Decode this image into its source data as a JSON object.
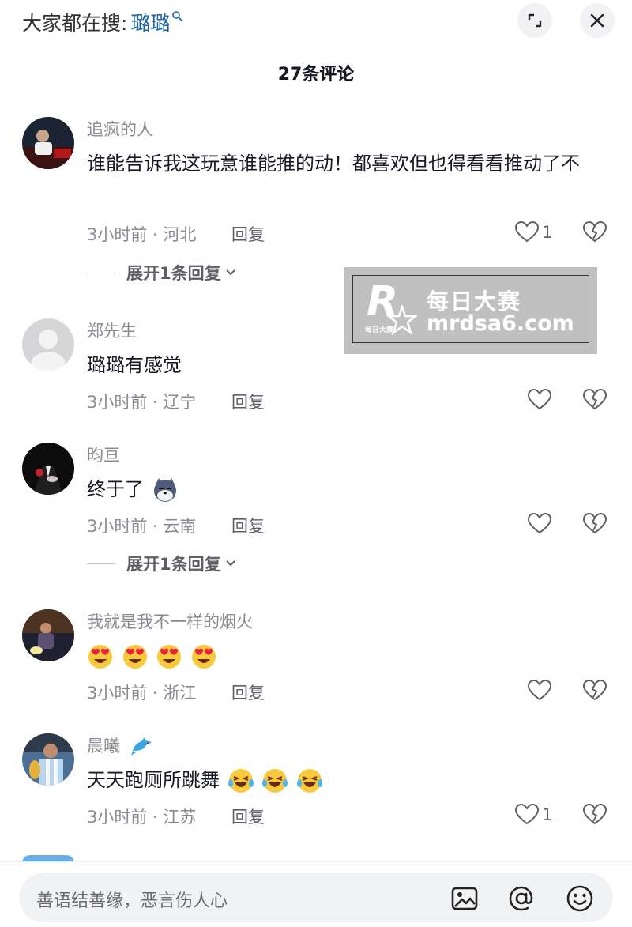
{
  "header": {
    "trending_label": "大家都在搜:",
    "trending_keyword": "璐璐"
  },
  "comment_count": "27条评论",
  "comments": [
    {
      "username": "追疯的人",
      "text": "谁能告诉我这玩意谁能推的动！都喜欢但也得看看推动了不",
      "meta": "3小时前 · 河北",
      "reply_label": "回复",
      "likes": "1",
      "expand_label": "展开1条回复"
    },
    {
      "username": "郑先生",
      "text": "璐璐有感觉",
      "meta": "3小时前 · 辽宁",
      "reply_label": "回复",
      "likes": ""
    },
    {
      "username": "昀亘",
      "text": "终于了",
      "meta": "3小时前 · 云南",
      "reply_label": "回复",
      "likes": "",
      "expand_label": "展开1条回复"
    },
    {
      "username": "我就是我不一样的烟火",
      "text": "",
      "meta": "3小时前 · 浙江",
      "reply_label": "回复",
      "likes": ""
    },
    {
      "username": "晨曦",
      "text": "天天跑厕所跳舞",
      "meta": "3小时前 · 江苏",
      "reply_label": "回复",
      "likes": "1"
    }
  ],
  "watermark": {
    "line1": "每日大赛",
    "line2": "mrdsa6.com",
    "logo_letter": "R",
    "logo_small": "每日大赛"
  },
  "input": {
    "placeholder": "善语结善缘，恶言伤人心"
  },
  "icons": [
    "search-icon",
    "expand-icon",
    "close-icon",
    "heart-icon",
    "broken-heart-icon",
    "chevron-down-icon",
    "image-icon",
    "at-icon",
    "emoji-icon",
    "dolphin-icon"
  ],
  "colors": {
    "keyword": "#1a5fa8",
    "meta": "#8a8b91",
    "text": "#161823",
    "input_bg": "#f1f2f4"
  }
}
